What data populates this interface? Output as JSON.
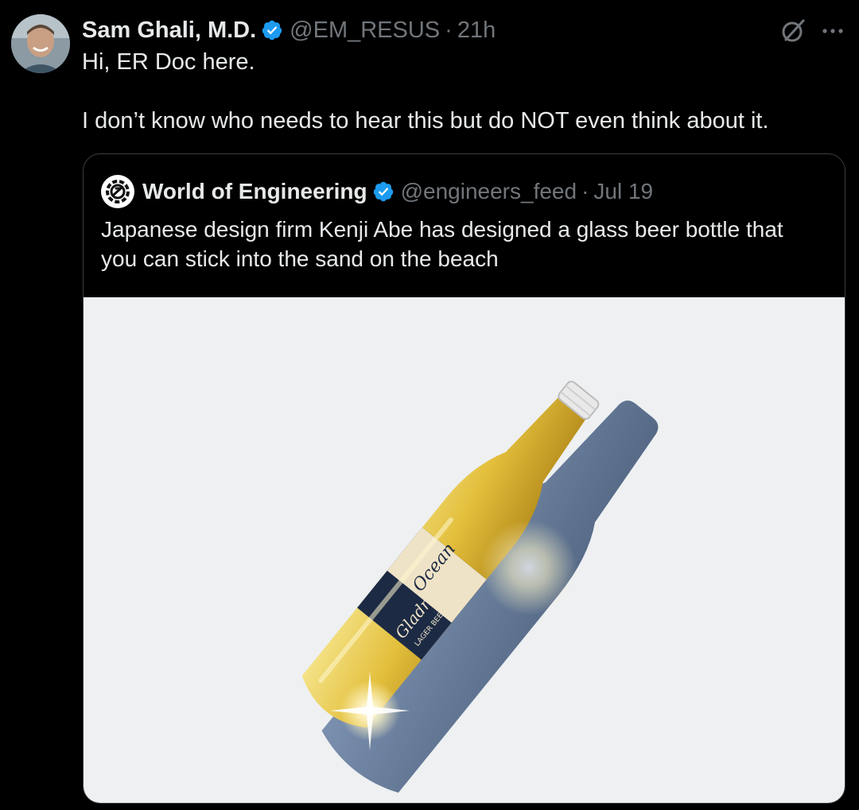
{
  "tweet": {
    "author_name": "Sam Ghali, M.D.",
    "author_handle": "@EM_RESUS",
    "separator": "·",
    "time": "21h",
    "text_lines": [
      "Hi, ER Doc here.",
      "I don’t know who needs to hear this but do NOT even think about it."
    ]
  },
  "icons": {
    "verified": "verified-badge-icon",
    "grok": "grok-icon",
    "more": "more-icon"
  },
  "quote": {
    "author_name": "World of Engineering",
    "author_handle": "@engineers_feed",
    "separator": "·",
    "date": "Jul 19",
    "text_lines": [
      "Japanese design firm Kenji Abe has designed a glass beer bottle that",
      "you can stick into the sand on the beach"
    ],
    "label_word": "Ocean Gladness",
    "label_sub": "LAGER BEER"
  },
  "colors": {
    "background": "#000000",
    "text": "#e7e9ea",
    "muted": "#71767b",
    "verified": "#1d9bf0",
    "border": "#3a3d41"
  }
}
